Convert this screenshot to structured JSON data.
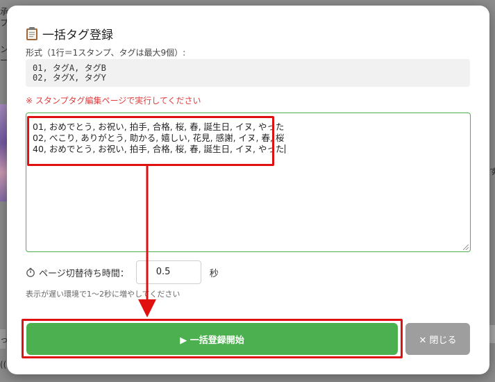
{
  "background": {
    "left_top_lines": [
      "承",
      "プ"
    ],
    "left_mid_lines": [
      "ン",
      "ー"
    ],
    "right_char": "す",
    "bottom_left_a": "っ",
    "bottom_left_b": "(("
  },
  "modal": {
    "title": "一括タグ登録",
    "format_label": "形式（1行＝1スタンプ、タグは最大9個）:",
    "example_lines": [
      "01, タグA, タグB",
      "02, タグX, タグY"
    ],
    "warning": "※ スタンプタグ編集ページで実行してください",
    "textarea_lines": [
      "01, おめでとう, お祝い, 拍手, 合格, 桜, 春, 誕生日, イヌ, やった",
      "02, べこり, ありがとう, 助かる, 嬉しい, 花見, 感謝, イヌ, 春, 桜",
      "40, おめでとう, お祝い, 拍手, 合格, 桜, 春, 誕生日, イヌ, やった"
    ],
    "wait_label": "ページ切替待ち時間：",
    "wait_value": "0.5",
    "wait_unit": "秒",
    "hint": "表示が遅い環境で1〜2秒に増やしてください",
    "start_button_label": "▶ 一括登録開始",
    "close_button_label": "✕ 閉じる"
  },
  "colors": {
    "accent_green": "#4caf50",
    "warning_red": "#e03b3b",
    "annotation_red": "#e01010",
    "close_gray": "#9e9e9e"
  },
  "icons": {
    "title_icon": "clipboard-icon",
    "wait_icon": "stopwatch-icon"
  }
}
